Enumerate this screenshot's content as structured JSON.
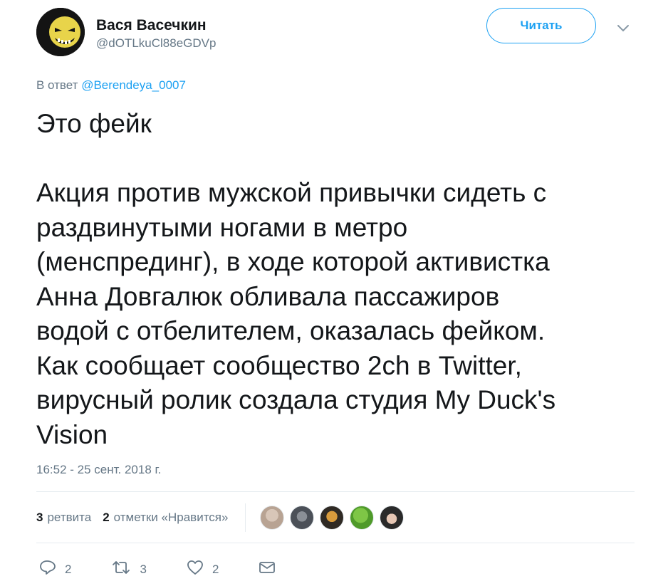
{
  "user": {
    "name": "Вася Васечкин",
    "handle": "@dOTLkuCl88eGDVp",
    "follow_label": "Читать"
  },
  "reply": {
    "prefix": "В ответ",
    "to": "@Berendeya_0007"
  },
  "tweet": {
    "text": "Это фейк\n\nАкция против мужской привычки сидеть с\nраздвинутыми ногами в метро\n(менспрединг), в ходе которой активистка\nАнна Довгалюк обливала пассажиров\nводой с отбелителем, оказалась фейком.\nКак сообщает сообщество 2ch в Twitter,\nвирусный ролик создала студия My Duck's\nVision",
    "timestamp": "16:52 - 25 сент. 2018 г."
  },
  "stats": {
    "retweets_count": "3",
    "retweets_label": "ретвита",
    "likes_count": "2",
    "likes_label": "отметки «Нравится»"
  },
  "actions": {
    "reply_count": "2",
    "retweet_count": "3",
    "like_count": "2"
  },
  "colors": {
    "accent": "#1da1f2",
    "muted": "#657786",
    "divider": "#e6ecf0"
  }
}
